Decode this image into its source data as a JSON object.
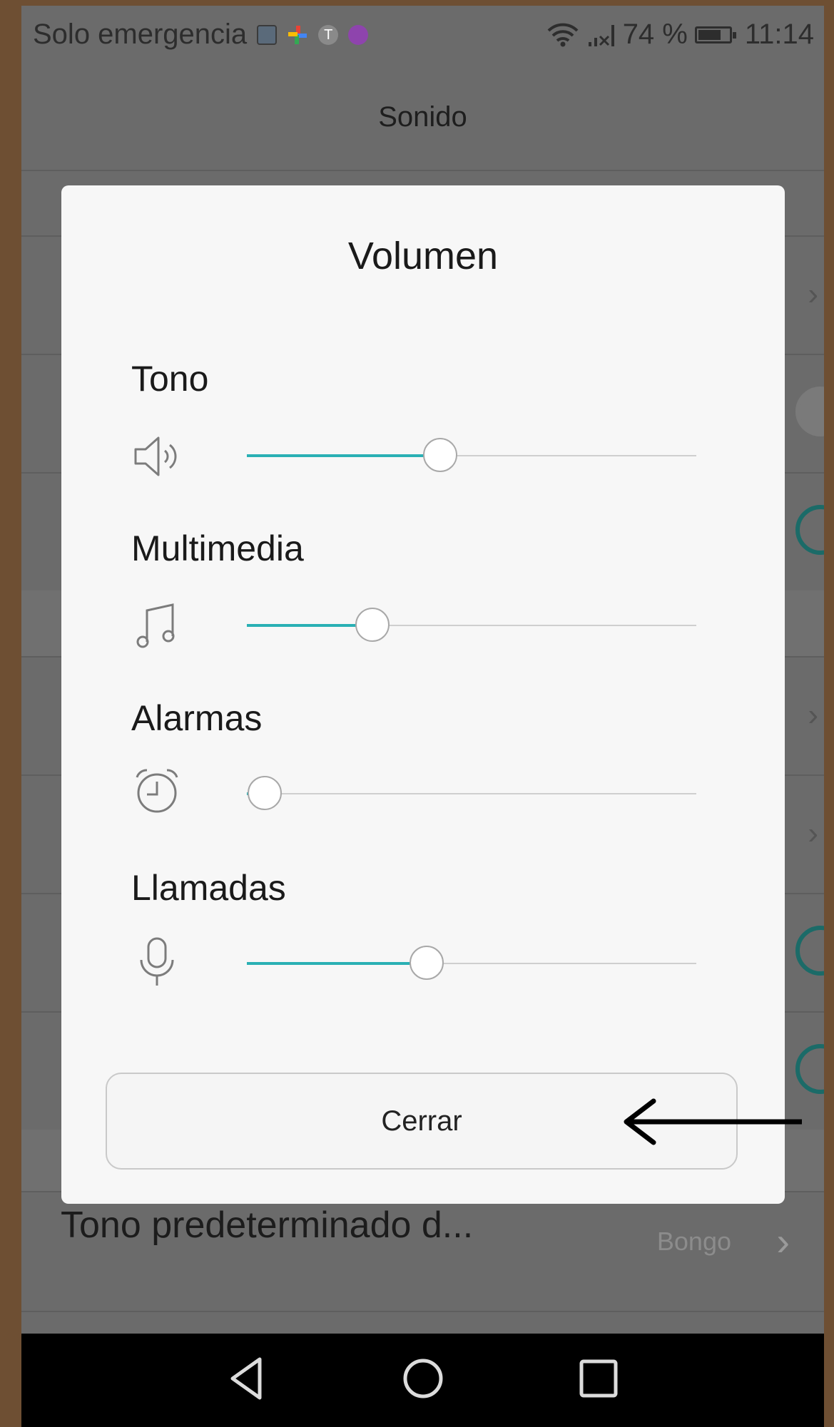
{
  "status_bar": {
    "carrier_text": "Solo emergencia",
    "battery_text": "74 %",
    "battery_level": 0.74,
    "time": "11:14",
    "notification_icons": [
      "gallery-icon",
      "pinwheel-icon",
      "t-icon",
      "keyboard-icon"
    ],
    "right_icons": [
      "wifi-icon",
      "no-signal-icon",
      "battery-icon"
    ]
  },
  "header": {
    "title": "Sonido"
  },
  "background_list": {
    "visible_item_label": "Tono predeterminado d...",
    "visible_item_value": "Bongo"
  },
  "dialog": {
    "title": "Volumen",
    "sliders": [
      {
        "label": "Tono",
        "icon": "speaker-icon",
        "level": 0.43
      },
      {
        "label": "Multimedia",
        "icon": "music-note-icon",
        "level": 0.28
      },
      {
        "label": "Alarmas",
        "icon": "alarm-clock-icon",
        "level": 0.04
      },
      {
        "label": "Llamadas",
        "icon": "microphone-icon",
        "level": 0.4
      }
    ],
    "close_label": "Cerrar"
  },
  "annotation": {
    "type": "arrow",
    "points_to": "close-button"
  },
  "navigation": [
    "back-icon",
    "home-icon",
    "recents-icon"
  ],
  "colors": {
    "accent": "#2ab0b4",
    "dialog_background": "#f7f7f7",
    "dim_background": "#6b6b6b",
    "frame": "#6e4f33"
  }
}
